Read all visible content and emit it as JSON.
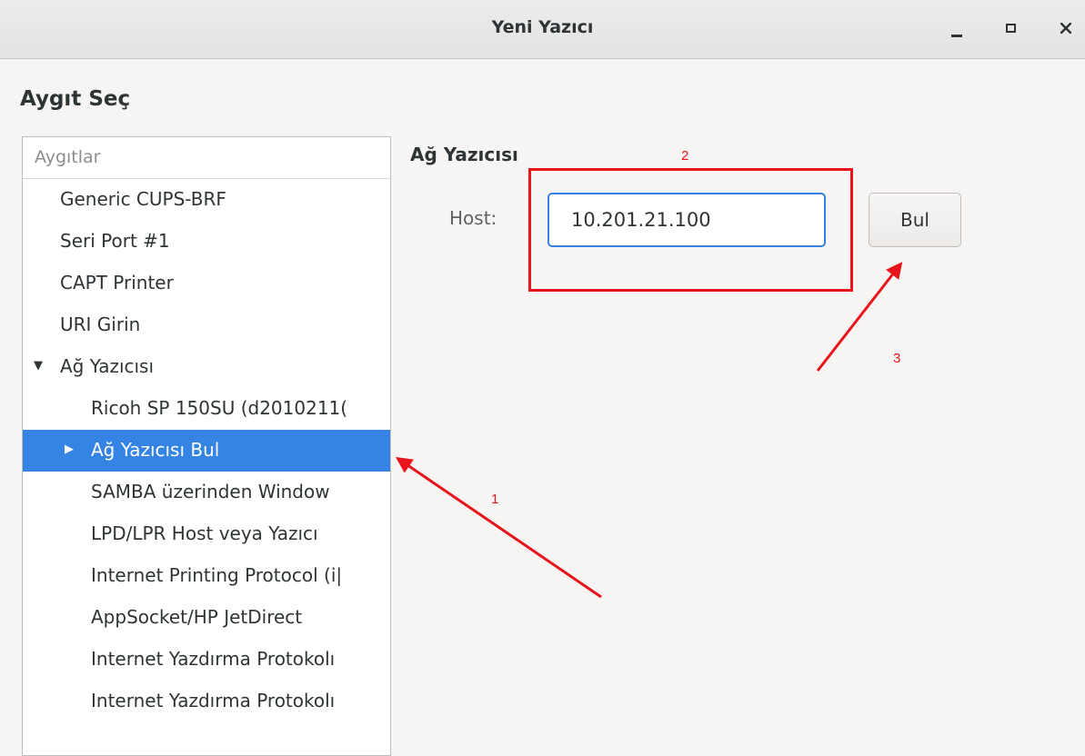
{
  "window": {
    "title": "Yeni Yazıcı",
    "controls": [
      "minimize-icon",
      "maximize-icon",
      "close-icon"
    ]
  },
  "page": {
    "heading": "Aygıt Seç"
  },
  "device_tree": {
    "header": "Aygıtlar",
    "items": [
      {
        "label": "Generic CUPS-BRF",
        "level": 0
      },
      {
        "label": "Seri Port #1",
        "level": 0
      },
      {
        "label": "CAPT Printer",
        "level": 0
      },
      {
        "label": "URI Girin",
        "level": 0
      },
      {
        "label": "Ağ Yazıcısı",
        "level": 0,
        "expander": "▼"
      },
      {
        "label": "Ricoh SP 150SU (d2010211(",
        "level": 1
      },
      {
        "label": "Ağ Yazıcısı Bul",
        "level": 1,
        "expander": "▶",
        "selected": true
      },
      {
        "label": "SAMBA üzerinden Window",
        "level": 1
      },
      {
        "label": "LPD/LPR Host veya Yazıcı",
        "level": 1
      },
      {
        "label": "Internet Printing Protocol (i|",
        "level": 1
      },
      {
        "label": "AppSocket/HP JetDirect",
        "level": 1
      },
      {
        "label": "Internet Yazdırma Protokolı",
        "level": 1
      },
      {
        "label": "Internet Yazdırma Protokolı",
        "level": 1
      }
    ]
  },
  "network_printer": {
    "section_label": "Ağ Yazıcısı",
    "host_label": "Host:",
    "host_value": "10.201.21.100",
    "find_button": "Bul"
  },
  "annotations": {
    "numbers": [
      "1",
      "2",
      "3"
    ],
    "color": "#e8141c"
  },
  "colors": {
    "selection": "#3584e4",
    "annotation": "#e8141c"
  }
}
